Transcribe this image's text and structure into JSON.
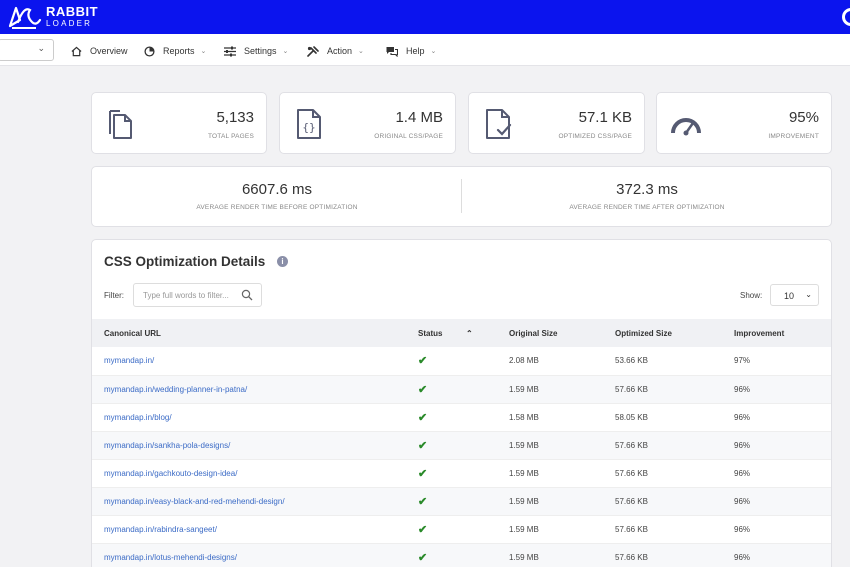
{
  "brand": {
    "line1": "RABBIT",
    "line2": "LOADER",
    "color": "#0b14ee"
  },
  "nav": {
    "domain_chevron": "⌄",
    "items": [
      {
        "label": "Overview",
        "icon": "home-icon",
        "has_caret": false
      },
      {
        "label": "Reports",
        "icon": "pie-chart-icon",
        "has_caret": true
      },
      {
        "label": "Settings",
        "icon": "sliders-icon",
        "has_caret": true
      },
      {
        "label": "Action",
        "icon": "tools-icon",
        "has_caret": true
      },
      {
        "label": "Help",
        "icon": "chat-icon",
        "has_caret": true
      }
    ]
  },
  "stats": [
    {
      "value": "5,133",
      "label": "TOTAL PAGES",
      "icon": "document-icon"
    },
    {
      "value": "1.4 MB",
      "label": "ORIGINAL CSS/PAGE",
      "icon": "css-file-icon"
    },
    {
      "value": "57.1 KB",
      "label": "OPTIMIZED CSS/PAGE",
      "icon": "file-check-icon"
    },
    {
      "value": "95%",
      "label": "IMPROVEMENT",
      "icon": "speedometer-icon"
    }
  ],
  "render": {
    "before": {
      "value": "6607.6 ms",
      "label": "AVERAGE RENDER TIME BEFORE OPTIMIZATION"
    },
    "after": {
      "value": "372.3 ms",
      "label": "AVERAGE RENDER TIME AFTER OPTIMIZATION"
    }
  },
  "details": {
    "title": "CSS Optimization Details",
    "info_glyph": "i",
    "filter_label": "Filter:",
    "filter_placeholder": "Type full words to filter...",
    "show_label": "Show:",
    "show_value": "10",
    "show_chevron": "⌄",
    "sort_glyph": "⌃",
    "columns": [
      "Canonical URL",
      "Status",
      "Original Size",
      "Optimized Size",
      "Improvement"
    ],
    "rows": [
      {
        "url": "mymandap.in/",
        "status": "✔",
        "original": "2.08 MB",
        "optimized": "53.66 KB",
        "improvement": "97%"
      },
      {
        "url": "mymandap.in/wedding-planner-in-patna/",
        "status": "✔",
        "original": "1.59 MB",
        "optimized": "57.66 KB",
        "improvement": "96%"
      },
      {
        "url": "mymandap.in/blog/",
        "status": "✔",
        "original": "1.58 MB",
        "optimized": "58.05 KB",
        "improvement": "96%"
      },
      {
        "url": "mymandap.in/sankha-pola-designs/",
        "status": "✔",
        "original": "1.59 MB",
        "optimized": "57.66 KB",
        "improvement": "96%"
      },
      {
        "url": "mymandap.in/gachkouto-design-idea/",
        "status": "✔",
        "original": "1.59 MB",
        "optimized": "57.66 KB",
        "improvement": "96%"
      },
      {
        "url": "mymandap.in/easy-black-and-red-mehendi-design/",
        "status": "✔",
        "original": "1.59 MB",
        "optimized": "57.66 KB",
        "improvement": "96%"
      },
      {
        "url": "mymandap.in/rabindra-sangeet/",
        "status": "✔",
        "original": "1.59 MB",
        "optimized": "57.66 KB",
        "improvement": "96%"
      },
      {
        "url": "mymandap.in/lotus-mehendi-designs/",
        "status": "✔",
        "original": "1.59 MB",
        "optimized": "57.66 KB",
        "improvement": "96%"
      }
    ]
  }
}
